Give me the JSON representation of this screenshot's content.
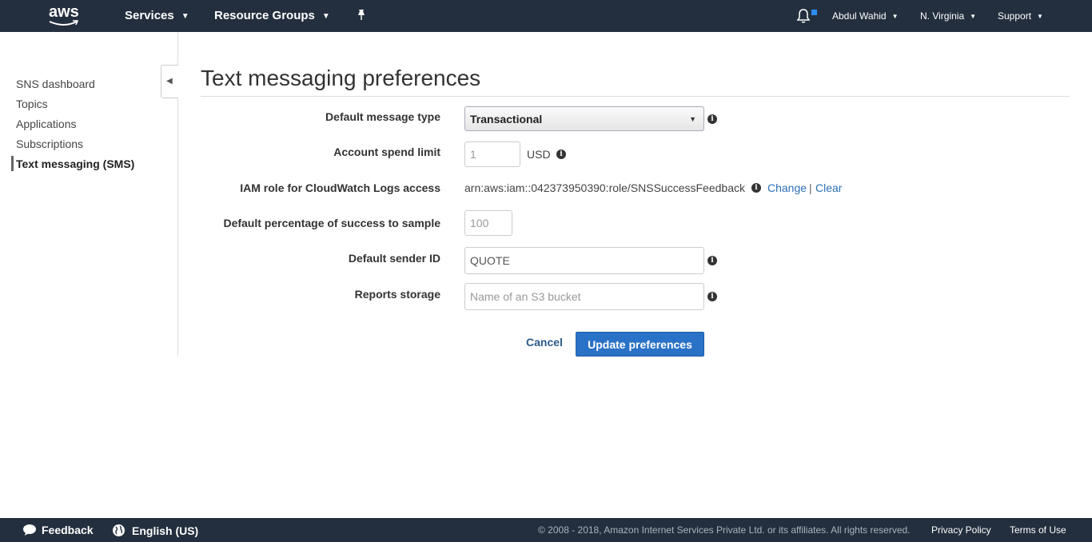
{
  "topnav": {
    "logo_text": "aws",
    "services_label": "Services",
    "resource_groups_label": "Resource Groups",
    "user_label": "Abdul Wahid",
    "region_label": "N. Virginia",
    "support_label": "Support",
    "icons": [
      "pin-icon",
      "bell-icon",
      "chevron-down-icon"
    ]
  },
  "sidebar": {
    "items": [
      {
        "label": "SNS dashboard"
      },
      {
        "label": "Topics"
      },
      {
        "label": "Applications"
      },
      {
        "label": "Subscriptions"
      },
      {
        "label": "Text messaging (SMS)",
        "active": true
      }
    ]
  },
  "main": {
    "title": "Text messaging preferences",
    "fields": {
      "message_type": {
        "label": "Default message type",
        "value": "Transactional"
      },
      "spend_limit": {
        "label": "Account spend limit",
        "placeholder": "1",
        "unit": "USD"
      },
      "iam_role": {
        "label": "IAM role for CloudWatch Logs access",
        "value": "arn:aws:iam::042373950390:role/SNSSuccessFeedback",
        "change_label": "Change",
        "separator": "|",
        "clear_label": "Clear"
      },
      "success_sample": {
        "label": "Default percentage of success to sample",
        "placeholder": "100"
      },
      "sender_id": {
        "label": "Default sender ID",
        "value": "QUOTE"
      },
      "reports_storage": {
        "label": "Reports storage",
        "placeholder": "Name of an S3 bucket"
      }
    },
    "cancel_label": "Cancel",
    "submit_label": "Update preferences"
  },
  "footer": {
    "feedback_label": "Feedback",
    "language_label": "English (US)",
    "copyright": "© 2008 - 2018, Amazon Internet Services Private Ltd. or its affiliates. All rights reserved.",
    "privacy_label": "Privacy Policy",
    "terms_label": "Terms of Use"
  },
  "colors": {
    "nav_bg": "#232f3e",
    "primary": "#2a72c7",
    "link": "#2a6fb8"
  }
}
